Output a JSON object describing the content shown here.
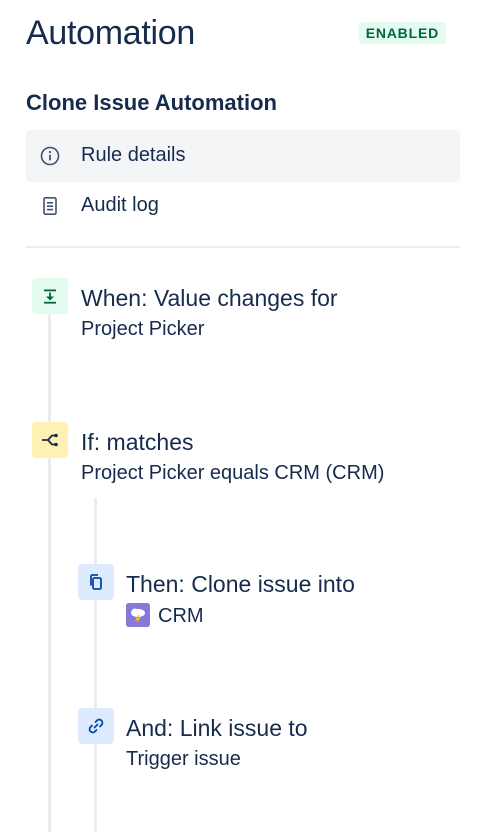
{
  "header": {
    "title": "Automation",
    "status": "ENABLED"
  },
  "rule": {
    "name": "Clone Issue Automation"
  },
  "nav": [
    {
      "label": "Rule details",
      "icon": "info-icon",
      "active": true
    },
    {
      "label": "Audit log",
      "icon": "document-icon",
      "active": false
    }
  ],
  "steps": {
    "trigger": {
      "title": "When: Value changes for",
      "detail": "Project Picker",
      "icon": "download-icon"
    },
    "condition": {
      "title": "If: matches",
      "detail": "Project Picker equals CRM (CRM)",
      "icon": "branch-icon"
    },
    "action_clone": {
      "title": "Then: Clone issue into",
      "detail": "CRM",
      "icon": "copy-icon"
    },
    "action_link": {
      "title": "And: Link issue to",
      "detail": "Trigger issue",
      "icon": "link-icon"
    }
  },
  "colors": {
    "status_bg": "#e3fcef",
    "status_text": "#006644",
    "trigger_bg": "#e3fcef",
    "condition_bg": "#fff0b3",
    "action_bg": "#deebff",
    "project_avatar": "#8777d9"
  }
}
